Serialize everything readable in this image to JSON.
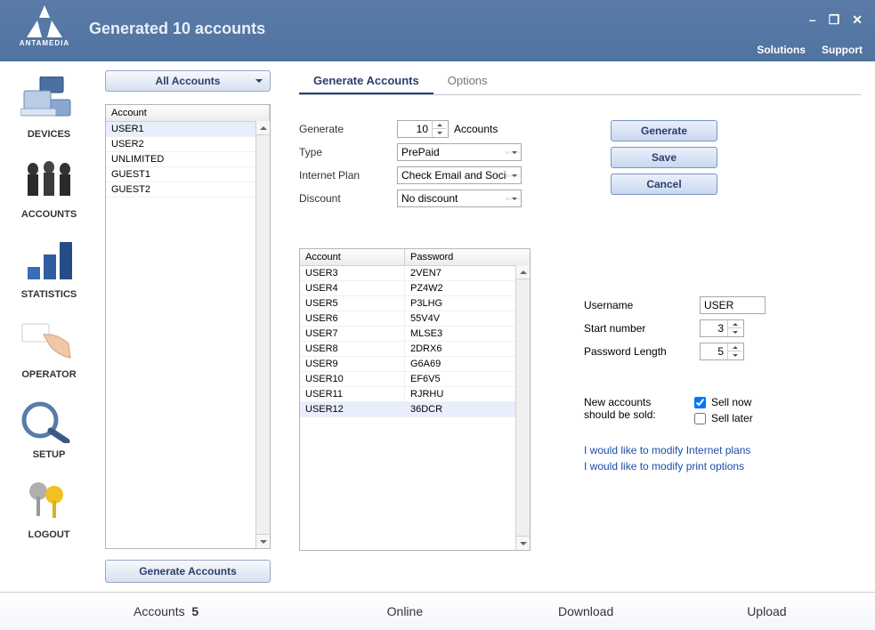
{
  "brand": "ANTAMEDIA",
  "title": "Generated 10 accounts",
  "title_links": {
    "solutions": "Solutions",
    "support": "Support"
  },
  "sidebar": [
    {
      "id": "devices",
      "label": "DEVICES"
    },
    {
      "id": "accounts",
      "label": "ACCOUNTS"
    },
    {
      "id": "statistics",
      "label": "STATISTICS"
    },
    {
      "id": "operator",
      "label": "OPERATOR"
    },
    {
      "id": "setup",
      "label": "SETUP"
    },
    {
      "id": "logout",
      "label": "LOGOUT"
    }
  ],
  "account_filter": "All Accounts",
  "account_list_header": "Account",
  "account_list": [
    "USER1",
    "USER2",
    "UNLIMITED",
    "GUEST1",
    "GUEST2"
  ],
  "generate_accounts_button": "Generate Accounts",
  "tabs": {
    "generate": "Generate Accounts",
    "options": "Options"
  },
  "form": {
    "generate_label": "Generate",
    "generate_count": "10",
    "generate_suffix": "Accounts",
    "type_label": "Type",
    "type_value": "PrePaid",
    "plan_label": "Internet Plan",
    "plan_value": "Check Email and Social Net",
    "discount_label": "Discount",
    "discount_value": "No discount"
  },
  "actions": {
    "generate": "Generate",
    "save": "Save",
    "cancel": "Cancel"
  },
  "gen_table": {
    "col_account": "Account",
    "col_password": "Password",
    "rows": [
      {
        "a": "USER3",
        "p": "2VEN7"
      },
      {
        "a": "USER4",
        "p": "PZ4W2"
      },
      {
        "a": "USER5",
        "p": "P3LHG"
      },
      {
        "a": "USER6",
        "p": "55V4V"
      },
      {
        "a": "USER7",
        "p": "MLSE3"
      },
      {
        "a": "USER8",
        "p": "2DRX6"
      },
      {
        "a": "USER9",
        "p": "G6A69"
      },
      {
        "a": "USER10",
        "p": "EF6V5"
      },
      {
        "a": "USER11",
        "p": "RJRHU"
      },
      {
        "a": "USER12",
        "p": "36DCR"
      }
    ]
  },
  "right_form": {
    "username_label": "Username",
    "username_value": "USER",
    "start_label": "Start number",
    "start_value": "3",
    "pwdlen_label": "Password Length",
    "pwdlen_value": "5"
  },
  "sell": {
    "label": "New accounts should be sold:",
    "sell_now": "Sell now",
    "sell_later": "Sell later",
    "sell_now_checked": true,
    "sell_later_checked": false
  },
  "links": {
    "modify_plans": "I would like to modify Internet plans",
    "modify_print": "I would like to modify print options"
  },
  "status": {
    "accounts_label": "Accounts",
    "accounts_count": "5",
    "online": "Online",
    "download": "Download",
    "upload": "Upload"
  }
}
